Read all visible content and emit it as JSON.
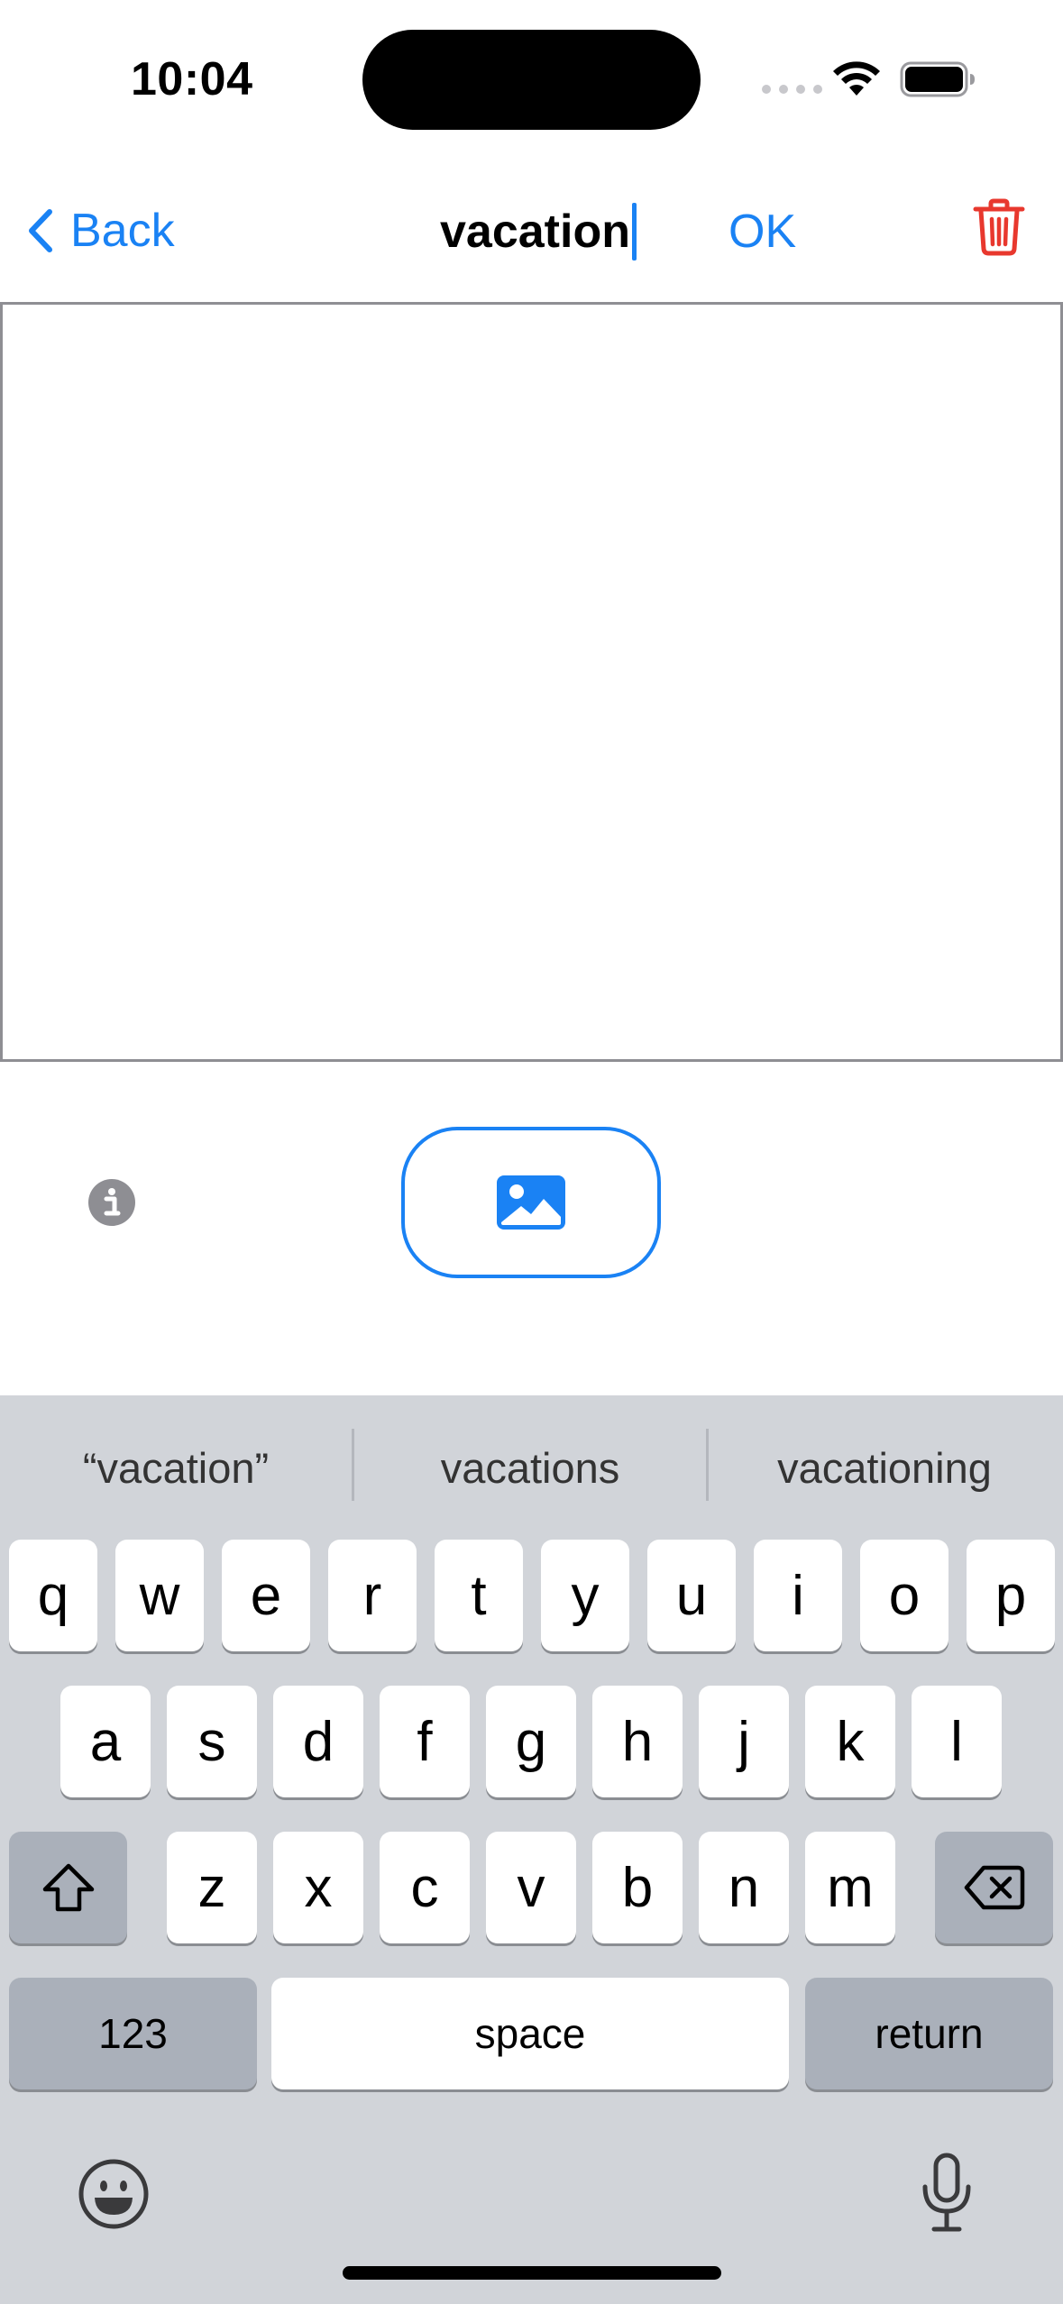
{
  "status_bar": {
    "time": "10:04",
    "icons": [
      "signal-dots-icon",
      "wifi-icon",
      "battery-icon"
    ]
  },
  "nav": {
    "back_label": "Back",
    "title": "vacation",
    "ok_label": "OK",
    "icons": [
      "chevron-left-icon",
      "trash-icon"
    ]
  },
  "controls": {
    "icons": [
      "info-icon",
      "photo-icon"
    ]
  },
  "keyboard": {
    "suggestions": [
      "“vacation”",
      "vacations",
      "vacationing"
    ],
    "row1": [
      "q",
      "w",
      "e",
      "r",
      "t",
      "y",
      "u",
      "i",
      "o",
      "p"
    ],
    "row2": [
      "a",
      "s",
      "d",
      "f",
      "g",
      "h",
      "j",
      "k",
      "l"
    ],
    "row3": [
      "z",
      "x",
      "c",
      "v",
      "b",
      "n",
      "m"
    ],
    "numbers_label": "123",
    "space_label": "space",
    "return_label": "return",
    "icons": [
      "shift-icon",
      "delete-icon",
      "emoji-icon",
      "microphone-icon"
    ]
  },
  "colors": {
    "accent": "#1a82f4",
    "destructive": "#e8382e",
    "keyboard_bg": "#d1d4d9",
    "key_dark": "#aab0ba",
    "info_gray": "#8e8e93"
  }
}
